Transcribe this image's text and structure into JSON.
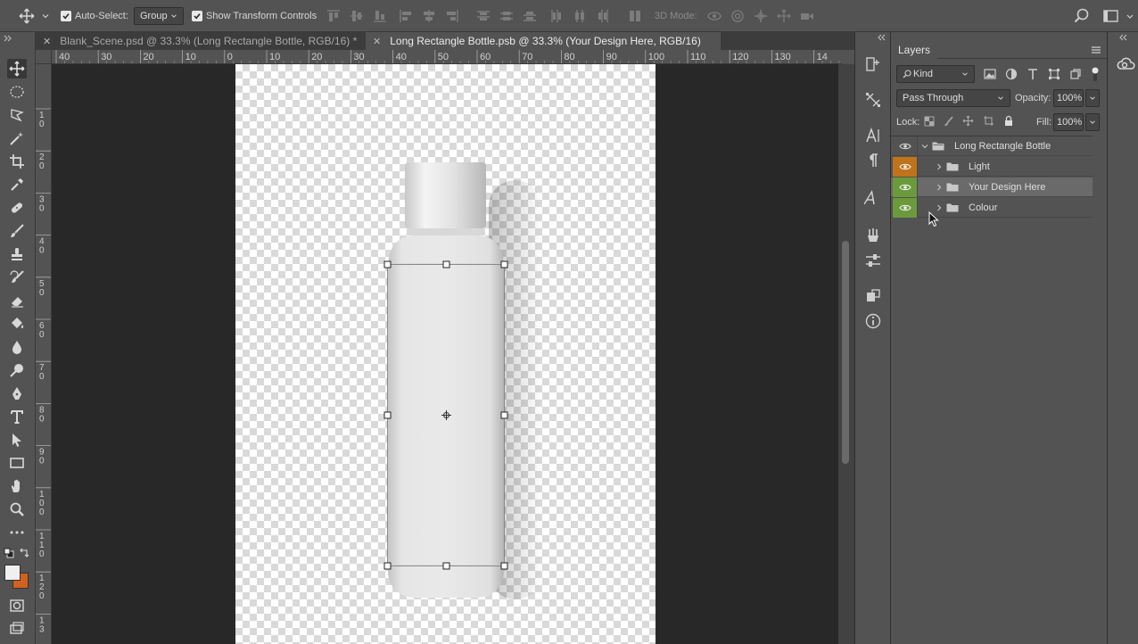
{
  "options_bar": {
    "auto_select_label": "Auto-Select:",
    "auto_select_value": "Group",
    "show_transform_label": "Show Transform Controls",
    "mode_3d_label": "3D Mode:"
  },
  "tabs": [
    {
      "label": "Blank_Scene.psd @ 33.3% (Long Rectangle Bottle, RGB/16) *",
      "active": false
    },
    {
      "label": "Long Rectangle Bottle.psb @ 33.3% (Your Design Here, RGB/16)",
      "active": true
    }
  ],
  "ruler_top": [
    "40",
    "30",
    "20",
    "10",
    "0",
    "10",
    "20",
    "30",
    "40",
    "50",
    "60",
    "70",
    "80",
    "90",
    "100",
    "110",
    "120",
    "130",
    "14"
  ],
  "ruler_left": [
    [
      "1",
      "0"
    ],
    [
      "2",
      "0"
    ],
    [
      "3",
      "0"
    ],
    [
      "4",
      "0"
    ],
    [
      "5",
      "0"
    ],
    [
      "6",
      "0"
    ],
    [
      "7",
      "0"
    ],
    [
      "8",
      "0"
    ],
    [
      "9",
      "0"
    ],
    [
      "1",
      "0",
      "0"
    ],
    [
      "1",
      "1",
      "0"
    ],
    [
      "1",
      "2",
      "0"
    ],
    [
      "1",
      "3"
    ]
  ],
  "layers_panel": {
    "title": "Layers",
    "filter_kind": "Kind",
    "blend_mode": "Pass Through",
    "opacity_label": "Opacity:",
    "opacity_value": "100%",
    "lock_label": "Lock:",
    "fill_label": "Fill:",
    "fill_value": "100%",
    "layers": [
      {
        "name": "Long Rectangle Bottle",
        "eye_color": "",
        "expanded": true,
        "indent": 0
      },
      {
        "name": "Light",
        "eye_color": "#c0731a",
        "expanded": false,
        "indent": 1
      },
      {
        "name": "Your Design Here",
        "eye_color": "#6b9a3c",
        "expanded": false,
        "indent": 1,
        "selected": true
      },
      {
        "name": "Colour",
        "eye_color": "#6b9a3c",
        "expanded": false,
        "indent": 1
      }
    ]
  },
  "colors": {
    "foreground": "#f0f0f0",
    "background": "#d2611f",
    "selected_layer_bg": "#6a6a6a"
  }
}
